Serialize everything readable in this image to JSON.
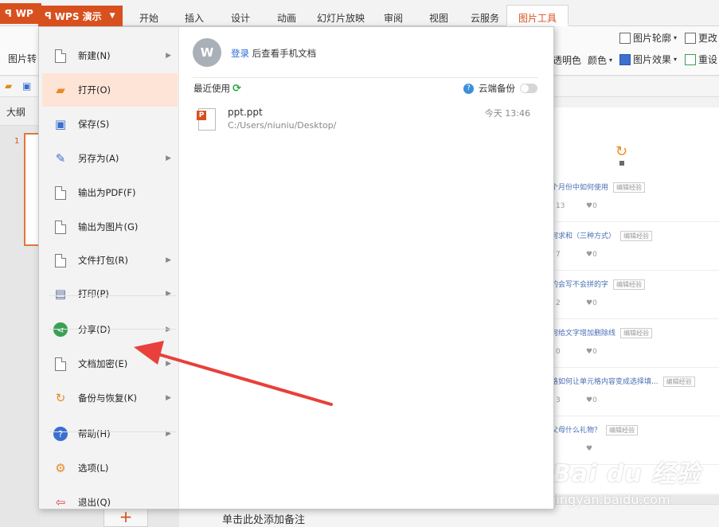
{
  "app": {
    "name": "WPS 演示",
    "bg_label": "WP"
  },
  "tabs": [
    "开始",
    "插入",
    "设计",
    "动画",
    "幻灯片放映",
    "审阅",
    "视图",
    "云服务",
    "图片工具"
  ],
  "ribbon": {
    "picture_convert": "图片转",
    "transparent": "透明色",
    "color": "颜色",
    "outline": "图片轮廓",
    "effect": "图片效果",
    "change_pic": "更改",
    "reset_pic": "重设"
  },
  "outline_tab": "大纲",
  "slide_number": "1",
  "file_menu": {
    "items": [
      {
        "label": "新建(N)",
        "icon": "new-doc-icon",
        "arrow": true
      },
      {
        "label": "打开(O)",
        "icon": "open-folder-icon",
        "arrow": false,
        "active": true
      },
      {
        "label": "保存(S)",
        "icon": "save-icon",
        "arrow": false
      },
      {
        "label": "另存为(A)",
        "icon": "save-as-icon",
        "arrow": true
      },
      {
        "label": "输出为PDF(F)",
        "icon": "pdf-icon",
        "arrow": false
      },
      {
        "label": "输出为图片(G)",
        "icon": "image-export-icon",
        "arrow": false
      },
      {
        "label": "文件打包(R)",
        "icon": "package-icon",
        "arrow": true
      },
      {
        "label": "打印(P)",
        "icon": "print-icon",
        "arrow": true
      },
      {
        "label": "分享(D)",
        "icon": "share-icon",
        "arrow": true
      },
      {
        "label": "文档加密(E)",
        "icon": "encrypt-icon",
        "arrow": true
      },
      {
        "label": "备份与恢复(K)",
        "icon": "backup-icon",
        "arrow": true
      },
      {
        "label": "帮助(H)",
        "icon": "help-icon",
        "arrow": true
      },
      {
        "label": "选项(L)",
        "icon": "options-gear-icon",
        "arrow": false
      },
      {
        "label": "退出(Q)",
        "icon": "exit-icon",
        "arrow": false
      }
    ],
    "avatar_letter": "W",
    "login_link": "登录",
    "login_text": " 后查看手机文档",
    "recent_label": "最近使用",
    "cloud_backup_label": "云端备份",
    "recent_files": [
      {
        "name": "ppt.ppt",
        "path": "C:/Users/niuniu/Desktop/",
        "time": "今天 13:46"
      }
    ]
  },
  "background_list": [
    {
      "title": "个月份中如何使用",
      "tag": "编辑经验",
      "views": "13",
      "likes": "0"
    },
    {
      "title": "何求和（三种方式）",
      "tag": "编辑经验",
      "views": "7",
      "likes": "0"
    },
    {
      "title": "的会写不会拼的字",
      "tag": "编辑经验",
      "views": "2",
      "likes": "0"
    },
    {
      "title": "何给文字增加删除线",
      "tag": "编辑经验",
      "views": "0",
      "likes": "0"
    },
    {
      "title": "格如何让单元格内容变成选择填...",
      "tag": "编辑经验",
      "views": "3",
      "likes": "0"
    },
    {
      "title": "父母什么礼物？",
      "tag": "编辑经验",
      "views": "",
      "likes": ""
    }
  ],
  "notes_placeholder": "单击此处添加备注",
  "add_slide_symbol": "+",
  "watermark": {
    "logo": "Bai du 经验",
    "url": "jingyan.baidu.com"
  },
  "colors": {
    "accent": "#d9501f",
    "active_item": "#fde4d6",
    "link": "#2e6fd9",
    "arrow": "#e8403a"
  }
}
